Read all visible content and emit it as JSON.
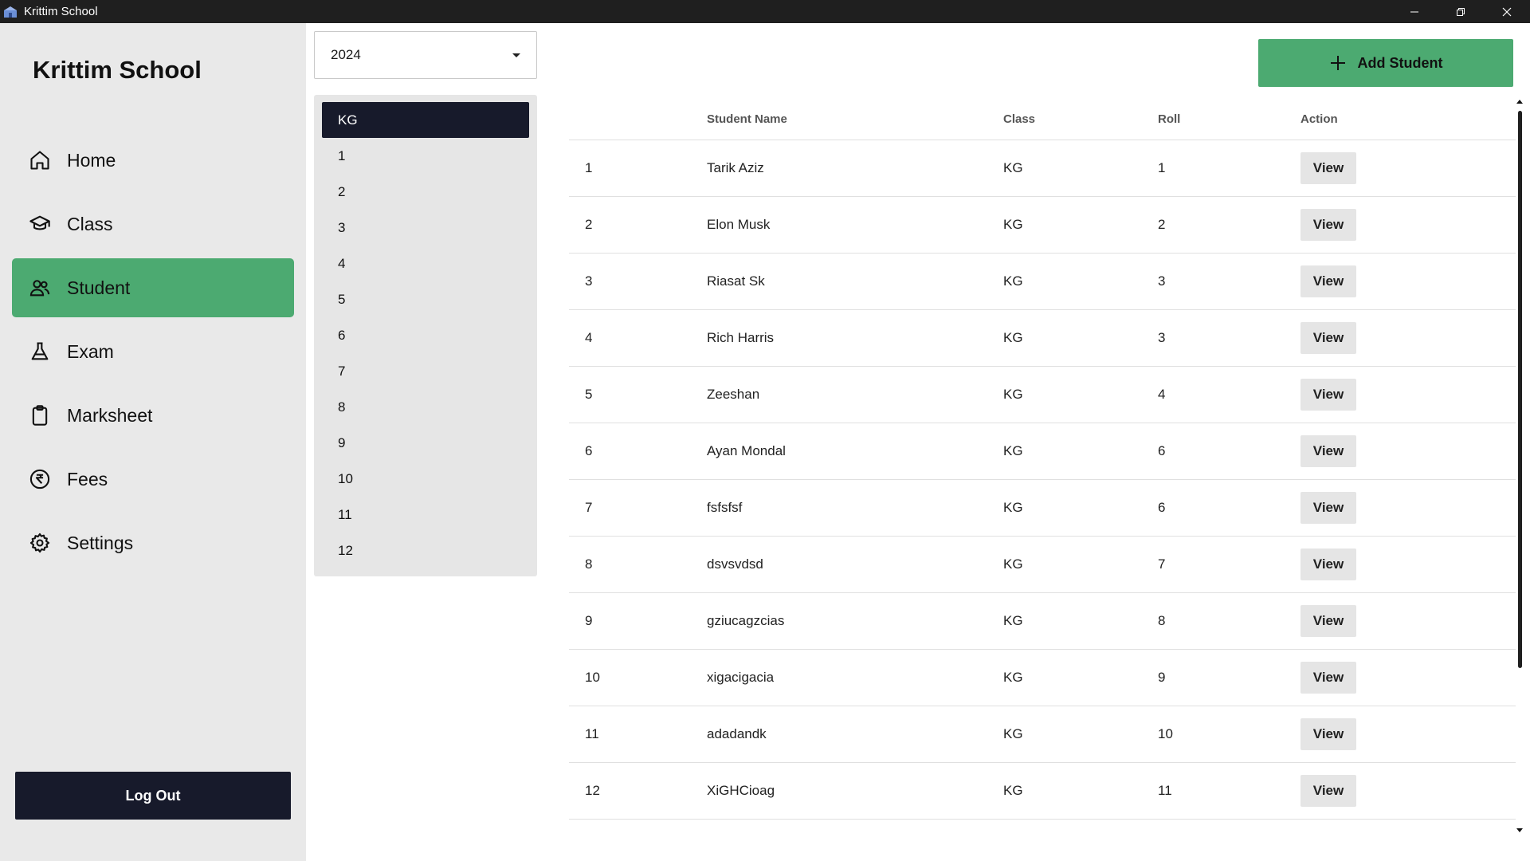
{
  "window": {
    "title": "Krittim School"
  },
  "sidebar": {
    "brand": "Krittim School",
    "items": [
      {
        "label": "Home",
        "icon": "home-icon"
      },
      {
        "label": "Class",
        "icon": "graduation-cap-icon"
      },
      {
        "label": "Student",
        "icon": "users-icon",
        "active": true
      },
      {
        "label": "Exam",
        "icon": "flask-icon"
      },
      {
        "label": "Marksheet",
        "icon": "clipboard-icon"
      },
      {
        "label": "Fees",
        "icon": "rupee-icon"
      },
      {
        "label": "Settings",
        "icon": "gear-icon"
      }
    ],
    "logout_label": "Log Out"
  },
  "filters": {
    "year": "2024",
    "classes": [
      "KG",
      "1",
      "2",
      "3",
      "4",
      "5",
      "6",
      "7",
      "8",
      "9",
      "10",
      "11",
      "12"
    ],
    "selected_class": "KG"
  },
  "toolbar": {
    "add_label": "Add Student"
  },
  "table": {
    "headers": [
      "",
      "Student Name",
      "Class",
      "Roll",
      "Action"
    ],
    "rows": [
      {
        "no": "1",
        "name": "Tarik Aziz",
        "class": "KG",
        "roll": "1",
        "action": "View"
      },
      {
        "no": "2",
        "name": "Elon Musk",
        "class": "KG",
        "roll": "2",
        "action": "View"
      },
      {
        "no": "3",
        "name": "Riasat Sk",
        "class": "KG",
        "roll": "3",
        "action": "View"
      },
      {
        "no": "4",
        "name": "Rich Harris",
        "class": "KG",
        "roll": "3",
        "action": "View"
      },
      {
        "no": "5",
        "name": "Zeeshan",
        "class": "KG",
        "roll": "4",
        "action": "View"
      },
      {
        "no": "6",
        "name": "Ayan Mondal",
        "class": "KG",
        "roll": "6",
        "action": "View"
      },
      {
        "no": "7",
        "name": "fsfsfsf",
        "class": "KG",
        "roll": "6",
        "action": "View"
      },
      {
        "no": "8",
        "name": "dsvsvdsd",
        "class": "KG",
        "roll": "7",
        "action": "View"
      },
      {
        "no": "9",
        "name": "gziucagzcias",
        "class": "KG",
        "roll": "8",
        "action": "View"
      },
      {
        "no": "10",
        "name": "xigacigacia",
        "class": "KG",
        "roll": "9",
        "action": "View"
      },
      {
        "no": "11",
        "name": "adadandk",
        "class": "KG",
        "roll": "10",
        "action": "View"
      },
      {
        "no": "12",
        "name": "XiGHCioag",
        "class": "KG",
        "roll": "11",
        "action": "View"
      }
    ]
  },
  "colors": {
    "accent": "#4caa71",
    "dark": "#171a2b",
    "sidebar_bg": "#e9e9e9"
  }
}
